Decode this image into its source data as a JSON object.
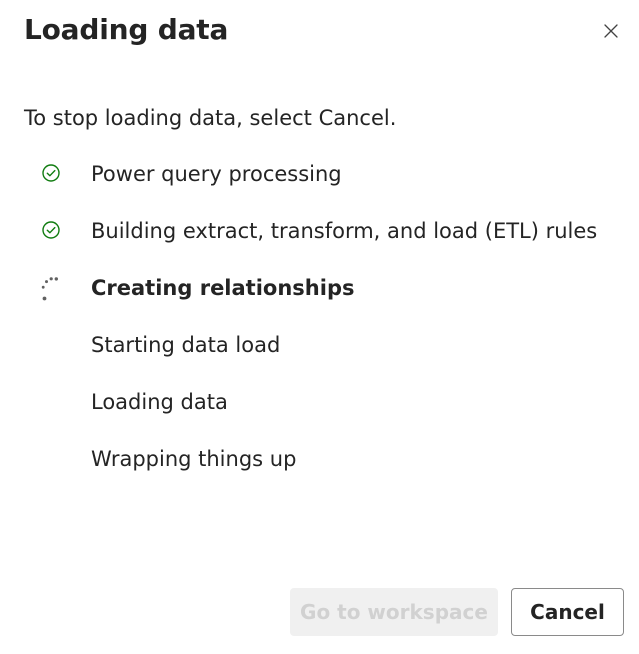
{
  "dialog": {
    "title": "Loading data",
    "close_icon": "close-icon",
    "instruction": "To stop loading data, select Cancel."
  },
  "steps": [
    {
      "label": "Power query processing",
      "status": "complete",
      "icon": "check-circle-icon"
    },
    {
      "label": "Building extract, transform, and load (ETL) rules",
      "status": "complete",
      "icon": "check-circle-icon"
    },
    {
      "label": "Creating relationships",
      "status": "in-progress",
      "icon": "spinner-icon"
    },
    {
      "label": "Starting data load",
      "status": "pending",
      "icon": ""
    },
    {
      "label": "Loading data",
      "status": "pending",
      "icon": ""
    },
    {
      "label": "Wrapping things up",
      "status": "pending",
      "icon": ""
    }
  ],
  "footer": {
    "primary_label": "Go to workspace",
    "primary_disabled": true,
    "secondary_label": "Cancel"
  },
  "colors": {
    "success": "#107c10",
    "text": "#242424",
    "disabled_bg": "#f0f0f0",
    "disabled_text": "#d1d1d1",
    "spinner": "#616161"
  }
}
